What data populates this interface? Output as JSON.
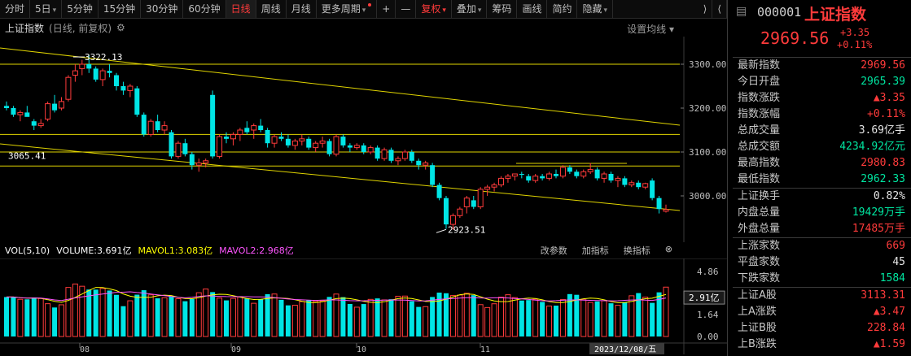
{
  "toolbar": {
    "items": [
      {
        "label": "分时"
      },
      {
        "label": "5日",
        "caret": true
      },
      {
        "label": "5分钟"
      },
      {
        "label": "15分钟"
      },
      {
        "label": "30分钟"
      },
      {
        "label": "60分钟"
      },
      {
        "label": "日线",
        "active": true
      },
      {
        "label": "周线"
      },
      {
        "label": "月线"
      },
      {
        "label": "更多周期",
        "caret": true,
        "dot": true
      },
      {
        "label": "+"
      },
      {
        "label": "—"
      },
      {
        "label": "复权",
        "caret": true,
        "red": true
      },
      {
        "label": "叠加",
        "caret": true
      },
      {
        "label": "筹码"
      },
      {
        "label": "画线"
      },
      {
        "label": "简约"
      },
      {
        "label": "隐藏",
        "caret": true
      }
    ]
  },
  "chart": {
    "title": "上证指数",
    "subtitle": "(日线, 前复权)",
    "settings_label": "设置均线",
    "settings_caret": "▾",
    "y_ticks": [
      "3300.00",
      "3200.00",
      "3100.00",
      "3000.00"
    ],
    "x_ticks": [
      "08",
      "09",
      "10",
      "11"
    ],
    "date_label": "2023/12/08/五",
    "annotations": {
      "high": "3322.13",
      "low": "2923.51",
      "level": "3065.41"
    }
  },
  "volume": {
    "label_name": "VOL(5,10)",
    "volume": "VOLUME:3.691亿",
    "ma1": "MAVOL1:3.083亿",
    "ma2": "MAVOL2:2.968亿",
    "tools": [
      "改参数",
      "加指标",
      "换指标"
    ],
    "y_ticks": [
      "4.86",
      "1.64",
      "0.00"
    ],
    "current": "2.91亿",
    "colors": {
      "vol_label": "#ffffff",
      "ma1": "#ffff00",
      "ma2": "#ff55ff"
    }
  },
  "panel": {
    "code": "000001",
    "name": "上证指数",
    "price": "2969.56",
    "change_abs": "+3.35",
    "change_pct": "+0.11%",
    "group1": [
      {
        "k": "最新指数",
        "v": "2969.56",
        "c": "red"
      },
      {
        "k": "今日开盘",
        "v": "2965.39",
        "c": "green"
      },
      {
        "k": "指数涨跌",
        "v": "▲3.35",
        "c": "red"
      },
      {
        "k": "指数涨幅",
        "v": "+0.11%",
        "c": "red"
      },
      {
        "k": "总成交量",
        "v": "3.69亿手",
        "c": "white"
      },
      {
        "k": "总成交额",
        "v": "4234.92亿元",
        "c": "green"
      },
      {
        "k": "最高指数",
        "v": "2980.83",
        "c": "red"
      },
      {
        "k": "最低指数",
        "v": "2962.33",
        "c": "green"
      }
    ],
    "group2": [
      {
        "k": "上证换手",
        "v": "0.82%",
        "c": "white"
      },
      {
        "k": "内盘总量",
        "v": "19429万手",
        "c": "green"
      },
      {
        "k": "外盘总量",
        "v": "17485万手",
        "c": "red"
      }
    ],
    "group3": [
      {
        "k": "上涨家数",
        "v": "669",
        "c": "red"
      },
      {
        "k": "平盘家数",
        "v": "45",
        "c": "white"
      },
      {
        "k": "下跌家数",
        "v": "1584",
        "c": "green"
      }
    ],
    "group4": [
      {
        "k": "上证A股",
        "v": "3113.31",
        "c": "red"
      },
      {
        "k": "上A涨跌",
        "v": "▲3.47",
        "c": "red"
      },
      {
        "k": "上证B股",
        "v": "228.84",
        "c": "red"
      },
      {
        "k": "上B涨跌",
        "v": "▲1.59",
        "c": "red"
      }
    ]
  },
  "colors": {
    "up": "#ff3b3b",
    "down": "#00e5e5",
    "grid": "#3a3a3a",
    "line": "#e0d400"
  }
}
